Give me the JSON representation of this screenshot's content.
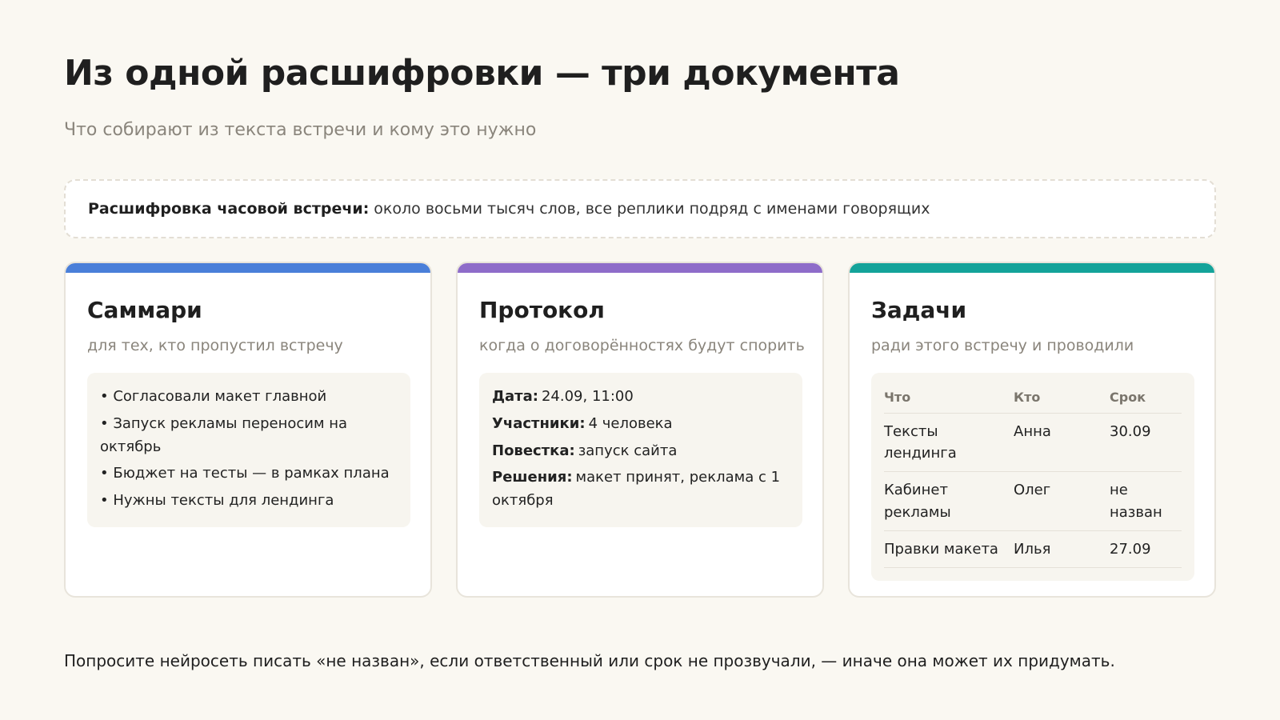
{
  "header": {
    "title": "Из одной расшифровки — три документа",
    "subtitle": "Что собирают из текста встречи и кому это нужно"
  },
  "source": {
    "label": "Расшифровка часовой встречи:",
    "text": "около восьми тысяч слов, все реплики подряд с именами говорящих"
  },
  "cards": {
    "summary": {
      "title": "Саммари",
      "subtitle": "для тех, кто пропустил встречу",
      "accent": "#4a7fd9",
      "items": [
        "• Согласовали макет главной",
        "• Запуск рекламы переносим на октябрь",
        "• Бюджет на тесты — в рамках плана",
        "• Нужны тексты для лендинга"
      ]
    },
    "protocol": {
      "title": "Протокол",
      "subtitle": "когда о договорённостях будут спорить",
      "accent": "#8e6cc9",
      "fields": [
        {
          "label": "Дата:",
          "value": "24.09, 11:00"
        },
        {
          "label": "Участники:",
          "value": "4 человека"
        },
        {
          "label": "Повестка:",
          "value": "запуск сайта"
        },
        {
          "label": "Решения:",
          "value": "макет принят, реклама с 1 октября"
        }
      ]
    },
    "tasks": {
      "title": "Задачи",
      "subtitle": "ради этого встречу и проводили",
      "accent": "#14a39a",
      "columns": [
        "Что",
        "Кто",
        "Срок"
      ],
      "rows": [
        [
          "Тексты лендинга",
          "Анна",
          "30.09"
        ],
        [
          "Кабинет рекламы",
          "Олег",
          "не назван"
        ],
        [
          "Правки макета",
          "Илья",
          "27.09"
        ]
      ]
    }
  },
  "footer": {
    "note": "Попросите нейросеть писать «не назван», если ответственный или срок не прозвучали, — иначе она может их придумать."
  }
}
